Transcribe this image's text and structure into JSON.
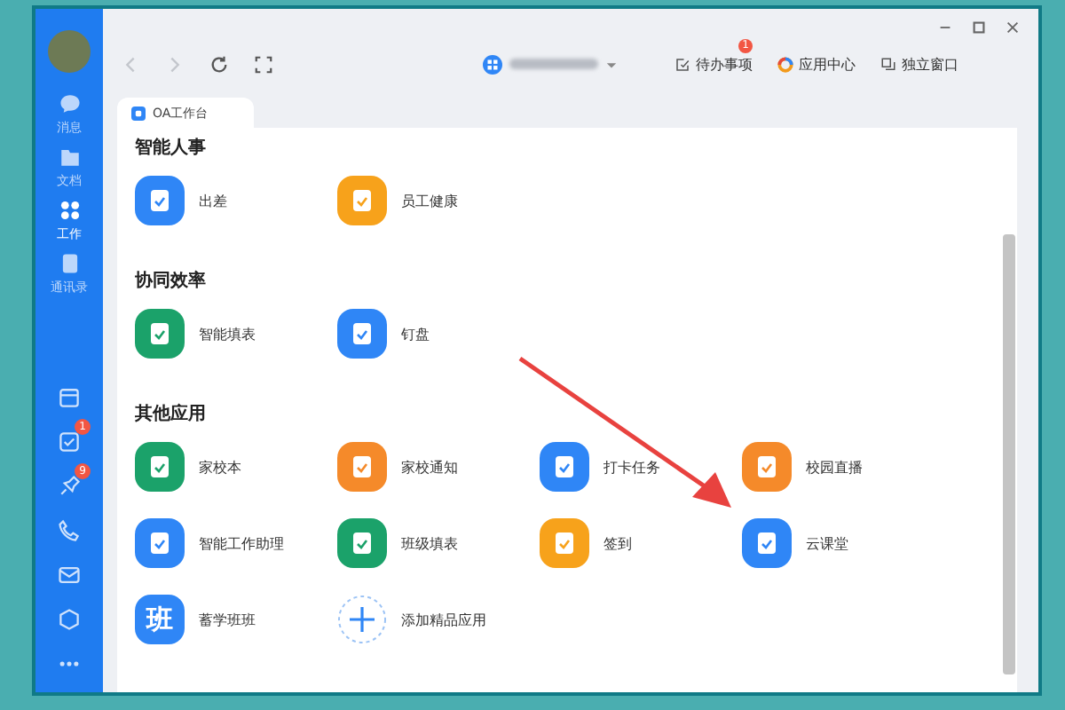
{
  "sidebar": {
    "items": [
      {
        "label": "消息",
        "selected": false
      },
      {
        "label": "文档",
        "selected": false
      },
      {
        "label": "工作",
        "selected": true
      },
      {
        "label": "通讯录",
        "selected": false
      }
    ],
    "bottom_icons": [
      {
        "kind": "plain"
      },
      {
        "kind": "badged",
        "badge": "1"
      },
      {
        "kind": "badged",
        "badge": "9"
      },
      {
        "kind": "plain"
      },
      {
        "kind": "plain"
      },
      {
        "kind": "plain"
      },
      {
        "kind": "plain"
      }
    ]
  },
  "toolbar": {
    "buttons": [
      {
        "label": "待办事项",
        "badge": "1"
      },
      {
        "label": "应用中心"
      },
      {
        "label": "独立窗口"
      }
    ]
  },
  "tabs": [
    {
      "label": "OA工作台",
      "selected": true
    }
  ],
  "sections": [
    {
      "title": "智能人事",
      "apps": [
        {
          "label": "出差",
          "color": "#2f86f6",
          "kind": "app"
        },
        {
          "label": "员工健康",
          "color": "#f7a21b",
          "kind": "app"
        }
      ]
    },
    {
      "title": "协同效率",
      "apps": [
        {
          "label": "智能填表",
          "color": "#1ba26a",
          "kind": "app"
        },
        {
          "label": "钉盘",
          "color": "#2f86f6",
          "kind": "app"
        }
      ]
    },
    {
      "title": "其他应用",
      "apps": [
        {
          "label": "家校本",
          "color": "#1ba26a",
          "kind": "app"
        },
        {
          "label": "家校通知",
          "color": "#f58a2a",
          "kind": "app"
        },
        {
          "label": "打卡任务",
          "color": "#2f86f6",
          "kind": "app"
        },
        {
          "label": "校园直播",
          "color": "#f58a2a",
          "kind": "app"
        },
        {
          "label": "智能工作助理",
          "color": "#2f86f6",
          "kind": "app"
        },
        {
          "label": "班级填表",
          "color": "#1ba26a",
          "kind": "app"
        },
        {
          "label": "签到",
          "color": "#f7a21b",
          "kind": "app"
        },
        {
          "label": "云课堂",
          "color": "#2f86f6",
          "kind": "app"
        },
        {
          "label": "蓄学班班",
          "color": "#2f86f6",
          "kind": "text",
          "icon_text": "班"
        },
        {
          "label": "添加精品应用",
          "kind": "add"
        }
      ]
    }
  ]
}
